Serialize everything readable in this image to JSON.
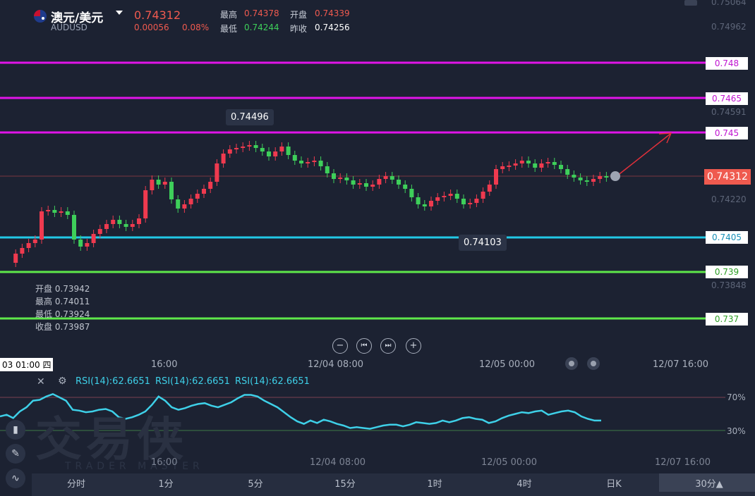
{
  "header": {
    "title": "澳元/美元",
    "symbol": "AUDUSD",
    "price": "0.74312",
    "change": "0.00056",
    "change_pct": "0.08%",
    "high_label": "最高",
    "high_value": "0.74378",
    "open_label": "开盘",
    "open_value": "0.74339",
    "low_label": "最低",
    "low_value": "0.74244",
    "prev_close_label": "昨收",
    "prev_close_value": "0.74256"
  },
  "price_axis": {
    "top": "0.75064",
    "p1": "0.74962",
    "p2": "0.74591",
    "p3": "0.74220",
    "p4": "0.73848",
    "current": "0.74312"
  },
  "levels": [
    {
      "label": "0.748",
      "color": "#e014e8"
    },
    {
      "label": "0.7465",
      "color": "#e014e8"
    },
    {
      "label": "0.745",
      "color": "#e014e8"
    },
    {
      "label": "0.7405",
      "color": "#22c8e6"
    },
    {
      "label": "0.739",
      "color": "#5ee84a"
    },
    {
      "label": "0.737",
      "color": "#5ee84a"
    }
  ],
  "tooltips": {
    "high": "0.74496",
    "low": "0.74103"
  },
  "ohlc": {
    "open": "开盘 0.73942",
    "high": "最高 0.74011",
    "low": "最低 0.73924",
    "close": "收盘 0.73987"
  },
  "nav": {
    "zoom_out": "−",
    "start": "⏮",
    "end": "⏭",
    "zoom_in": "+"
  },
  "time_axis": {
    "cursor": "03 01:00 四",
    "t1": "16:00",
    "t2": "12/04 08:00",
    "t3": "12/05 00:00",
    "t4": "12/07 16:00"
  },
  "rsi": {
    "label1": "RSI(14):62.6651",
    "label2": "RSI(14):62.6651",
    "label3": "RSI(14):62.6651",
    "level_high": "70%",
    "level_low": "30%",
    "values": [
      47,
      49,
      45,
      53,
      58,
      66,
      67,
      71,
      74,
      70,
      66,
      55,
      54,
      52,
      53,
      55,
      56,
      53,
      46,
      44,
      46,
      49,
      53,
      61,
      71,
      66,
      58,
      55,
      57,
      60,
      62,
      63,
      60,
      58,
      61,
      64,
      69,
      73,
      73,
      71,
      66,
      62,
      58,
      52,
      46,
      41,
      38,
      42,
      39,
      43,
      41,
      38,
      36,
      33,
      34,
      33,
      32,
      34,
      36,
      37,
      37,
      35,
      37,
      40,
      39,
      38,
      39,
      42,
      40,
      42,
      45,
      46,
      44,
      43,
      39,
      41,
      45,
      48,
      50,
      52,
      51,
      53,
      54,
      49,
      51,
      53,
      54,
      52,
      47,
      44,
      42,
      42
    ]
  },
  "timeframes": [
    "分时",
    "1分",
    "5分",
    "15分",
    "1时",
    "4时",
    "日K",
    "30分▲"
  ],
  "watermark": {
    "cn": "交易侠",
    "en": "TRADER MASTER"
  },
  "colors": {
    "up": "#ef3a4f",
    "down": "#3ecf5a",
    "background": "#1c2232",
    "rsi": "#3ed0e8",
    "current_price": "#ef5a4f"
  }
}
